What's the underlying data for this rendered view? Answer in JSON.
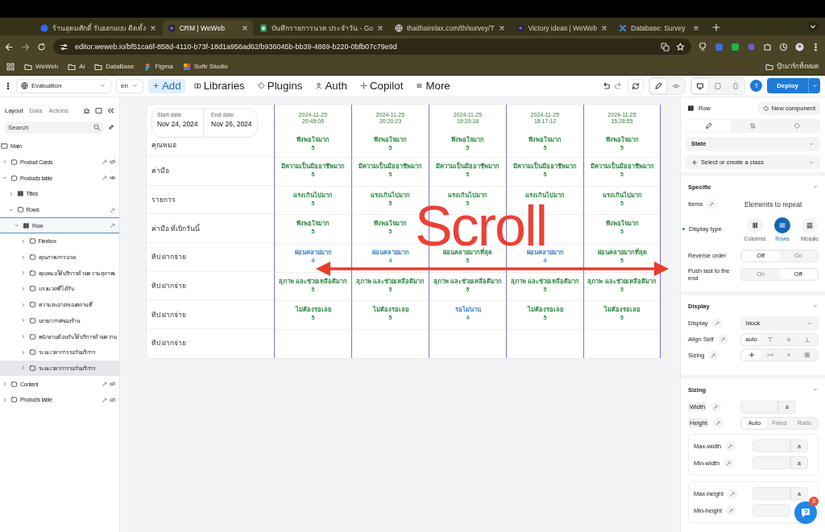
{
  "browser": {
    "tabs": [
      {
        "title": "ร้านอุดมศักดิ์ รับออกแบบ ติดตั้ง",
        "selected": false
      },
      {
        "title": "CRM | WeWeb",
        "selected": true
      },
      {
        "title": "บันทึกรายการนวด ประจำวัน - Go",
        "selected": false
      },
      {
        "title": "thaithairelax.com/th/survey/T",
        "selected": false
      },
      {
        "title": "Victory ideas | WeWeb",
        "selected": false
      },
      {
        "title": "Database: Survey",
        "selected": false
      }
    ],
    "url": "editor.weweb.io/bf51ca6f-858d-4110-b73f-18d1a956ad62/b936045b-bb39-4869-b220-0bfb07c79e9d",
    "bookmarks": [
      "WeWeb",
      "Ai",
      "DataBase",
      "Figma",
      "Softr Studio"
    ],
    "all_bookmarks": "บุ๊กมาร์กทั้งหมด"
  },
  "toolbar": {
    "page": "Evaluation",
    "language": "en",
    "menu": [
      {
        "label": "Add",
        "selected": true
      },
      {
        "label": "Libraries",
        "selected": false
      },
      {
        "label": "Plugins",
        "selected": false
      },
      {
        "label": "Auth",
        "selected": false
      },
      {
        "label": "Copilot",
        "selected": false
      },
      {
        "label": "More",
        "selected": false
      }
    ],
    "modes": [
      {
        "selected": true
      },
      {
        "selected": false
      }
    ],
    "devices": [
      {
        "selected": true
      },
      {
        "selected": false
      },
      {
        "selected": false
      }
    ],
    "avatar": "T",
    "deploy": "Deploy"
  },
  "layers": {
    "tabs": [
      {
        "label": "Layout",
        "selected": true
      },
      {
        "label": "Data",
        "selected": false
      },
      {
        "label": "Actions",
        "selected": false
      }
    ],
    "search": {
      "placeholder": "Search"
    },
    "tree": [
      {
        "label": "Main",
        "kind": "page",
        "selected": false,
        "children": [
          {
            "label": "Product Cards",
            "kind": "container",
            "expanded": false,
            "selected": false,
            "bound": true,
            "visible": false
          },
          {
            "label": "Products table",
            "kind": "container",
            "expanded": true,
            "selected": false,
            "bound": true,
            "visible": true,
            "children": [
              {
                "label": "Titles",
                "kind": "columns",
                "expanded": false,
                "selected": false,
                "bound": false
              },
              {
                "label": "Rows",
                "kind": "container",
                "expanded": true,
                "selected": false,
                "bound": true,
                "children": [
                  {
                    "label": "Row",
                    "kind": "columns",
                    "expanded": true,
                    "selected": true,
                    "bound": true,
                    "children": [
                      {
                        "label": "Flexbox",
                        "kind": "container",
                        "expanded": false,
                        "selected": false,
                        "hovered": false
                      },
                      {
                        "label": "คุณภาพการนวด",
                        "kind": "container",
                        "expanded": false,
                        "selected": false,
                        "hovered": false
                      },
                      {
                        "label": "คุณหมอให้บริการด้วยความสุภาพเ",
                        "kind": "container",
                        "expanded": false,
                        "selected": false,
                        "hovered": false
                      },
                      {
                        "label": "แรงนวดที่ได้รับ",
                        "kind": "container",
                        "expanded": false,
                        "selected": false,
                        "hovered": false
                      },
                      {
                        "label": "ความสะอาดของสถานที่",
                        "kind": "container",
                        "expanded": false,
                        "selected": false,
                        "hovered": false
                      },
                      {
                        "label": "บรรยากาศของร้าน",
                        "kind": "container",
                        "expanded": false,
                        "selected": false,
                        "hovered": false
                      },
                      {
                        "label": "พนักงานต้อนรับให้บริการด้วยความ",
                        "kind": "container",
                        "expanded": false,
                        "selected": false,
                        "hovered": false
                      },
                      {
                        "label": "ระยะเวลาการรอรับบริการ",
                        "kind": "container",
                        "expanded": false,
                        "selected": false,
                        "hovered": false
                      },
                      {
                        "label": "ระยะเวลาการรอรับบริการ",
                        "kind": "container",
                        "expanded": false,
                        "selected": false,
                        "hovered": true
                      }
                    ]
                  }
                ]
              }
            ]
          },
          {
            "label": "Content",
            "kind": "container",
            "expanded": false,
            "selected": false,
            "bound": true,
            "visible": false
          },
          {
            "label": "Products table",
            "kind": "container",
            "expanded": false,
            "selected": false,
            "bound": true,
            "visible": false
          }
        ]
      }
    ]
  },
  "table": {
    "date_range": {
      "start_label": "Start date",
      "start": "Nov 24, 2024",
      "end_label": "End date",
      "end": "Nov 26, 2024"
    },
    "row_labels": [
      "คุณหมอ",
      "ค่ามือ",
      "รายการ",
      "ค่ามือ ที่เบิกวันนี้",
      "ทิป ฝากจ่าย",
      "ทิป ฝากจ่าย",
      "ทิป ฝากจ่าย",
      "ทิป ฝากจ่าย"
    ],
    "columns": [
      {
        "date": "2024-11-25",
        "time": "20:45:05",
        "cells": [
          {
            "text": "พึงพอใจมาก",
            "score": "5",
            "color": "#2e8540"
          },
          {
            "text": "มีความเป็นมืออาชีพมาก",
            "score": "5",
            "color": "#2e8540"
          },
          {
            "text": "แรงเกินไปมาก",
            "score": "5",
            "color": "#2e8540"
          },
          {
            "text": "พึงพอใจมาก",
            "score": "5",
            "color": "#2e8540"
          },
          {
            "text": "ผ่อนคลายมาก",
            "score": "4",
            "color": "#3a7fc1"
          },
          {
            "text": "สุภาพ และช่วยเหลือดีมาก",
            "score": "5",
            "color": "#2e8540"
          },
          {
            "text": "ไม่ต้องรอเลย",
            "score": "5",
            "color": "#2e8540"
          }
        ]
      },
      {
        "date": "2024-11-25",
        "time": "20:20:23",
        "cells": [
          {
            "text": "พึงพอใจมาก",
            "score": "5",
            "color": "#2e8540"
          },
          {
            "text": "มีความเป็นมืออาชีพมาก",
            "score": "5",
            "color": "#2e8540"
          },
          {
            "text": "แรงเกินไปมาก",
            "score": "5",
            "color": "#2e8540"
          },
          {
            "text": "พึงพอใจมาก",
            "score": "5",
            "color": "#2e8540"
          },
          {
            "text": "ผ่อนคลายมาก",
            "score": "4",
            "color": "#3a7fc1"
          },
          {
            "text": "สุภาพ และช่วยเหลือดีมาก",
            "score": "5",
            "color": "#2e8540"
          },
          {
            "text": "ไม่ต้องรอเลย",
            "score": "5",
            "color": "#2e8540"
          }
        ]
      },
      {
        "date": "2024-11-25",
        "time": "19:20:18",
        "cells": [
          {
            "text": "พึงพอใจมาก",
            "score": "5",
            "color": "#2e8540"
          },
          {
            "text": "มีความเป็นมืออาชีพมาก",
            "score": "5",
            "color": "#2e8540"
          },
          {
            "text": "แรงเกินไปมาก",
            "score": "5",
            "color": "#2e8540"
          },
          null,
          {
            "text": "ผ่อนคลายมากที่สุด",
            "score": "5",
            "color": "#2e8540"
          },
          {
            "text": "สุภาพ และช่วยเหลือดีมาก",
            "score": "5",
            "color": "#2e8540"
          },
          {
            "text": "รอไม่นาน",
            "score": "4",
            "color": "#3a7fc1"
          }
        ]
      },
      {
        "date": "2024-11-25",
        "time": "18:17:12",
        "cells": [
          {
            "text": "พึงพอใจมาก",
            "score": "5",
            "color": "#2e8540"
          },
          {
            "text": "มีความเป็นมืออาชีพมาก",
            "score": "5",
            "color": "#2e8540"
          },
          {
            "text": "แรงเกินไปมาก",
            "color": "#2e8540"
          },
          null,
          {
            "text": "ผ่อนคลายมาก",
            "score": "4",
            "color": "#3a7fc1"
          },
          {
            "text": "สุภาพ และช่วยเหลือดีมาก",
            "score": "5",
            "color": "#2e8540"
          },
          {
            "text": "ไม่ต้องรอเลย",
            "score": "5",
            "color": "#2e8540"
          }
        ]
      },
      {
        "date": "2024-11-25",
        "time": "15:28:55",
        "cells": [
          {
            "text": "พึงพอใจมาก",
            "score": "5",
            "color": "#2e8540"
          },
          {
            "text": "มีความเป็นมืออาชีพมาก",
            "score": "5",
            "color": "#2e8540"
          },
          {
            "text": "แรงเกินไปมาก",
            "score": "5",
            "color": "#2e8540"
          },
          {
            "text": "พึงพอใจมาก",
            "score": "5",
            "color": "#2e8540"
          },
          {
            "text": "ผ่อนคลายมากที่สุด",
            "score": "5",
            "color": "#2e8540"
          },
          {
            "text": "สุภาพ และช่วยเหลือดีมาก",
            "score": "5",
            "color": "#2e8540"
          },
          {
            "text": "ไม่ต้องรอเลย",
            "score": "5",
            "color": "#2e8540"
          }
        ]
      }
    ],
    "annotation": {
      "text": "Scroll"
    }
  },
  "inspector": {
    "element": "Row",
    "new_component": "New component",
    "tabs": [
      {
        "selected": true
      },
      {
        "selected": false
      },
      {
        "selected": false
      }
    ],
    "state": "State",
    "class_select": "Select or create a class",
    "specific": {
      "title": "Specific",
      "items_label": "Items",
      "items_value": "Elements to repeat",
      "display_type_label": "Display type",
      "display_type_modified": true,
      "display_types": [
        {
          "label": "Columns",
          "selected": false
        },
        {
          "label": "Rows",
          "selected": true
        },
        {
          "label": "Mosaic",
          "selected": false
        }
      ],
      "reverse_label": "Reverse order",
      "reverse_options": [
        {
          "label": "Off",
          "selected": true
        },
        {
          "label": "On",
          "selected": false
        }
      ],
      "push_label": "Push last to the end",
      "push_options": [
        {
          "label": "On",
          "selected": false
        },
        {
          "label": "Off",
          "selected": true
        }
      ]
    },
    "display": {
      "title": "Display",
      "display_label": "Display",
      "display_value": "block",
      "align_label": "Align Self",
      "align_options": [
        {
          "kind": "text",
          "label": "auto",
          "selected": true
        },
        {
          "kind": "icon",
          "selected": false
        },
        {
          "kind": "icon",
          "selected": false
        },
        {
          "kind": "icon",
          "selected": false
        }
      ],
      "sizing_label": "Sizing",
      "sizing_options": [
        {
          "selected": true
        },
        {
          "selected": false
        },
        {
          "selected": false
        },
        {
          "selected": false
        }
      ]
    },
    "sizing": {
      "title": "Sizing",
      "width_label": "Width",
      "width_unit": "a",
      "height_label": "Height",
      "height_options": [
        {
          "label": "Auto",
          "selected": true
        },
        {
          "label": "Fixed",
          "selected": false
        },
        {
          "label": "Ratio",
          "selected": false
        }
      ],
      "groups": [
        [
          {
            "label": "Max-width",
            "unit": "a"
          },
          {
            "label": "Min-width",
            "unit": "a"
          }
        ],
        [
          {
            "label": "Max-height",
            "unit": "a"
          },
          {
            "label": "Min-height"
          }
        ]
      ]
    },
    "help": {
      "badge": "3"
    }
  }
}
